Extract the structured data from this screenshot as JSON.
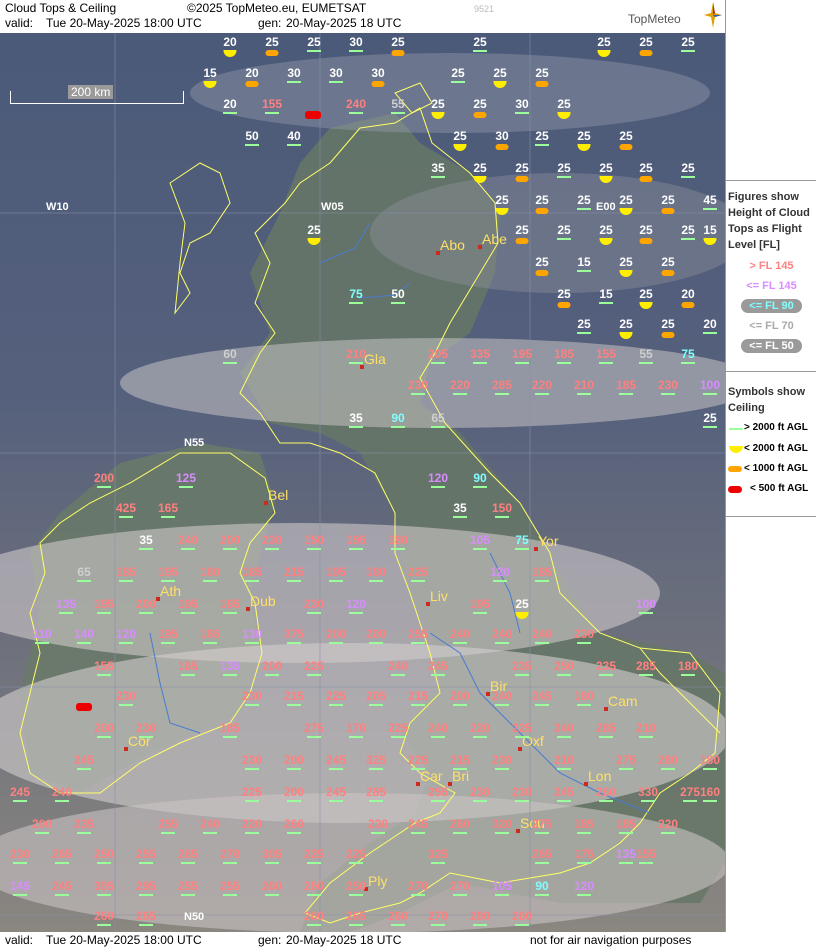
{
  "header": {
    "title": "Cloud Tops & Ceiling",
    "copyright": "©2025 TopMeteo.eu, EUMETSAT",
    "valid_label": "valid:",
    "valid_value": "Tue   20-May-2025   18:00 UTC",
    "gen_label": "gen:",
    "gen_value": "20-May-2025 18 UTC",
    "code": "9521",
    "brand": "TopMeteo"
  },
  "map": {
    "scale_label": "200 km",
    "grid_labels": [
      "W10",
      "W05",
      "E00",
      "N55",
      "N50"
    ],
    "cities": [
      "Abo",
      "Abe",
      "Gla",
      "Bel",
      "Yor",
      "Liv",
      "Ath",
      "Dub",
      "Bir",
      "Cam",
      "Cor",
      "Oxf",
      "Car",
      "Bri",
      "Lon",
      "Sou",
      "Ply"
    ],
    "colors": {
      "above_145": "#ff8080",
      "below_145": "#d98cff",
      "below_90": "#80ffff",
      "below_70": "#d0d0d0",
      "below_50": "#ffffff",
      "ceiling_2000": "#ffee00",
      "ceiling_1000": "#ffa500",
      "ceiling_500": "#ee0000",
      "ceiling_ok": "#9aff9a"
    },
    "labels": [
      "20",
      "25",
      "25",
      "30",
      "25",
      "25",
      "25",
      "25",
      "25",
      "15",
      "20",
      "30",
      "30",
      "30",
      "25",
      "25",
      "25",
      "20",
      "155",
      "240",
      "55",
      "25",
      "25",
      "30",
      "25",
      "50",
      "40",
      "25",
      "30",
      "25",
      "25",
      "25",
      "35",
      "25",
      "25",
      "25",
      "25",
      "25",
      "25",
      "25",
      "25",
      "25",
      "25",
      "25",
      "45",
      "25",
      "25",
      "25",
      "25",
      "25",
      "25",
      "15",
      "25",
      "15",
      "25",
      "25",
      "75",
      "50",
      "25",
      "15",
      "25",
      "20",
      "25",
      "25",
      "25",
      "20",
      "60",
      "210",
      "205",
      "335",
      "195",
      "185",
      "155",
      "55",
      "75",
      "230",
      "220",
      "285",
      "220",
      "210",
      "185",
      "230",
      "100",
      "35",
      "90",
      "65",
      "25",
      "120",
      "90",
      "200",
      "125",
      "425",
      "165",
      "35",
      "150",
      "35",
      "240",
      "200",
      "230",
      "150",
      "195",
      "180",
      "105",
      "75",
      "65",
      "185",
      "195",
      "180",
      "185",
      "215",
      "195",
      "180",
      "225",
      "120",
      "185",
      "135",
      "195",
      "200",
      "195",
      "185",
      "230",
      "120",
      "195",
      "25",
      "100",
      "110",
      "140",
      "120",
      "195",
      "165",
      "130",
      "375",
      "200",
      "200",
      "255",
      "240",
      "240",
      "240",
      "230",
      "155",
      "165",
      "135",
      "200",
      "225",
      "240",
      "245",
      "235",
      "250",
      "235",
      "285",
      "180",
      "230",
      "230",
      "215",
      "225",
      "205",
      "215",
      "200",
      "240",
      "245",
      "180",
      "200",
      "230",
      "185",
      "275",
      "170",
      "225",
      "240",
      "220",
      "225",
      "240",
      "285",
      "210",
      "245",
      "230",
      "200",
      "245",
      "325",
      "225",
      "215",
      "230",
      "210",
      "275",
      "280",
      "180",
      "245",
      "240",
      "225",
      "200",
      "245",
      "285",
      "255",
      "230",
      "230",
      "245",
      "260",
      "330",
      "275",
      "160",
      "200",
      "235",
      "255",
      "240",
      "220",
      "260",
      "230",
      "245",
      "260",
      "320",
      "275",
      "185",
      "185",
      "220",
      "230",
      "265",
      "250",
      "255",
      "265",
      "270",
      "305",
      "225",
      "225",
      "325",
      "265",
      "175",
      "135",
      "155",
      "145",
      "245",
      "305",
      "295",
      "255",
      "255",
      "260",
      "260",
      "250",
      "270",
      "270",
      "105",
      "90",
      "120",
      "260",
      "265",
      "260",
      "265",
      "260",
      "270",
      "280",
      "260"
    ]
  },
  "legend": {
    "figures_title": "Figures show Height of Cloud Tops as Flight Level  [FL]",
    "fl_rows": [
      "> FL 145",
      "<= FL 145",
      "<= FL 90",
      "<= FL 70",
      "<= FL 50"
    ],
    "symbols_title": "Symbols show Ceiling",
    "sym_rows": [
      "> 2000 ft AGL",
      "< 2000 ft AGL",
      "< 1000 ft AGL",
      "< 500 ft AGL"
    ]
  },
  "footer": {
    "valid_label": "valid:",
    "valid_value": "Tue   20-May-2025   18:00 UTC",
    "gen_label": "gen:",
    "gen_value": "20-May-2025 18 UTC",
    "disclaimer": "not for air navigation purposes"
  }
}
